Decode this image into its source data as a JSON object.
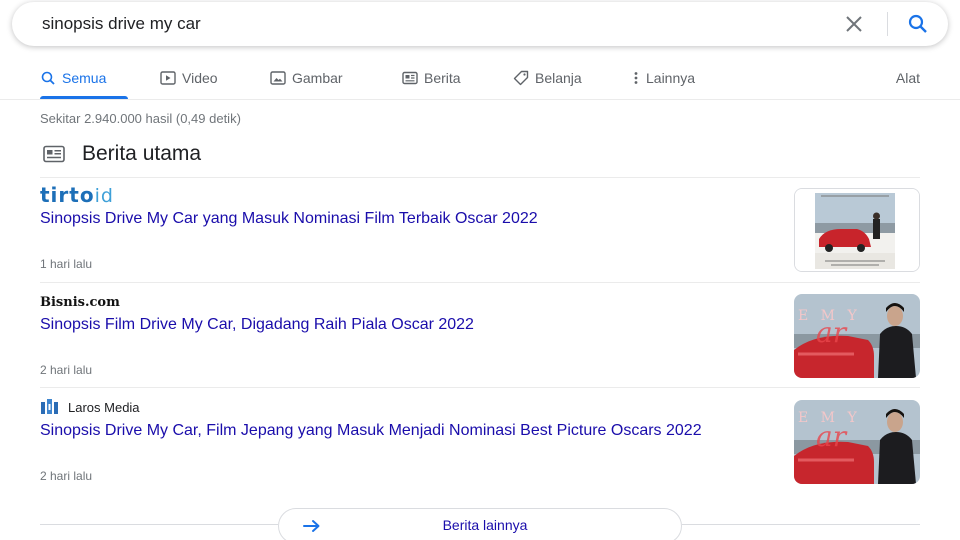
{
  "search": {
    "query": "sinopsis drive my car",
    "clear_icon": "close-icon",
    "search_icon": "search-icon"
  },
  "tabs": [
    {
      "label": "Semua",
      "icon": "search-icon",
      "active": true
    },
    {
      "label": "Video",
      "icon": "video-icon",
      "active": false
    },
    {
      "label": "Gambar",
      "icon": "image-icon",
      "active": false
    },
    {
      "label": "Berita",
      "icon": "news-icon",
      "active": false
    },
    {
      "label": "Belanja",
      "icon": "tag-icon",
      "active": false
    },
    {
      "label": "Lainnya",
      "icon": "more-vert-icon",
      "active": false
    }
  ],
  "tools_label": "Alat",
  "result_stats": "Sekitar 2.940.000 hasil (0,49 detik)",
  "top_stories": {
    "title": "Berita utama",
    "icon": "news-icon",
    "items": [
      {
        "source": "tirto",
        "source_suffix": "id",
        "headline": "Sinopsis Drive My Car yang Masuk Nominasi Film Terbaik Oscar 2022",
        "time": "1 hari lalu"
      },
      {
        "source": "Bisnis.com",
        "headline": "Sinopsis Film Drive My Car, Digadang Raih Piala Oscar 2022",
        "time": "2 hari lalu"
      },
      {
        "source": "Laros Media",
        "headline": "Sinopsis Drive My Car, Film Jepang yang Masuk Menjadi Nominasi Best Picture Oscars 2022",
        "time": "2 hari lalu"
      }
    ],
    "more_label": "Berita lainnya"
  },
  "colors": {
    "accent": "#1a73e8",
    "link": "#1a0dab",
    "muted": "#70757a",
    "tirto": "#1d6fb8"
  }
}
